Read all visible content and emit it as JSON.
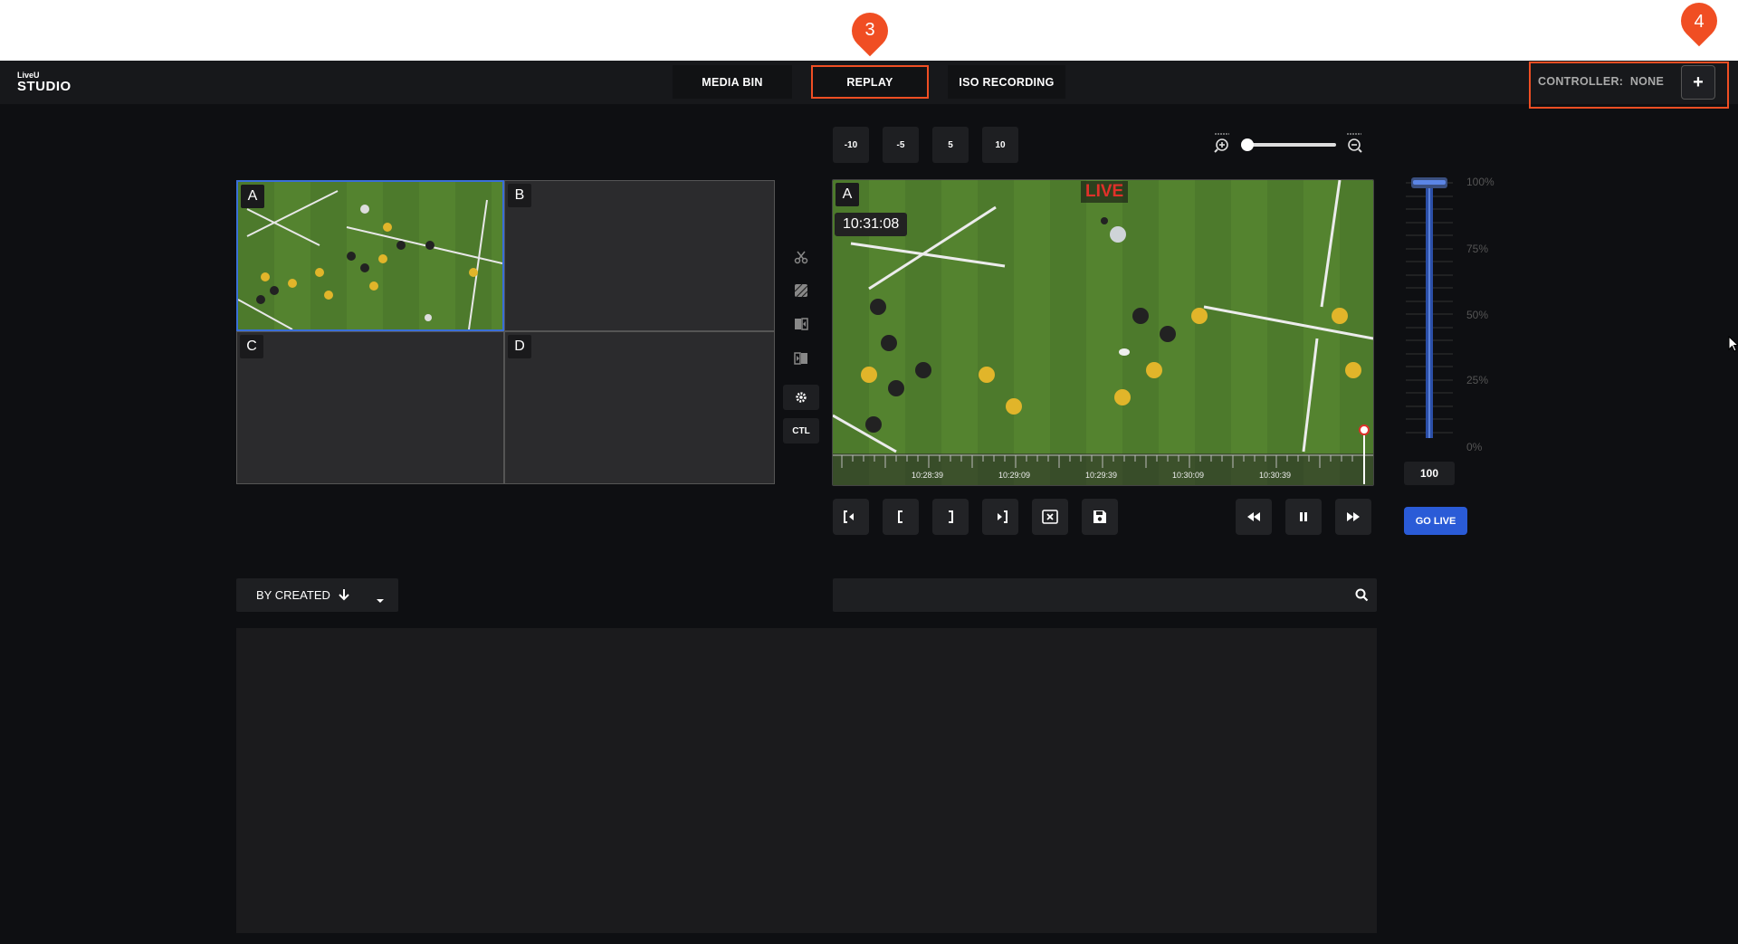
{
  "app": {
    "logo_top": "LiveU",
    "logo_bottom": "STUDIO"
  },
  "nav": {
    "media_bin": "MEDIA BIN",
    "replay": "REPLAY",
    "iso_recording": "ISO RECORDING"
  },
  "callouts": {
    "replay_num": "3",
    "controller_num": "4"
  },
  "controller": {
    "label": "CONTROLLER:",
    "value": "NONE",
    "add": "+"
  },
  "skip_buttons": [
    "-10",
    "-5",
    "5",
    "10"
  ],
  "grid": {
    "cells": [
      "A",
      "B",
      "C",
      "D"
    ]
  },
  "side_tools": {
    "ctl": "CTL"
  },
  "player": {
    "source": "A",
    "live_label": "LIVE",
    "timecode": "10:31:08",
    "timeline_ticks": [
      "10:28:39",
      "10:29:09",
      "10:29:39",
      "10:30:09",
      "10:30:39"
    ]
  },
  "volume": {
    "value": "100",
    "level_percent": 100,
    "scale": [
      "100%",
      "75%",
      "50%",
      "25%",
      "0%"
    ]
  },
  "go_live": "GO LIVE",
  "sort": {
    "label": "BY CREATED"
  },
  "search": {
    "placeholder": ""
  },
  "colors": {
    "accent_orange": "#f04e23",
    "live_red": "#e0312a",
    "go_live_blue": "#2a5bd7",
    "selected_border": "#3a6fd8"
  }
}
